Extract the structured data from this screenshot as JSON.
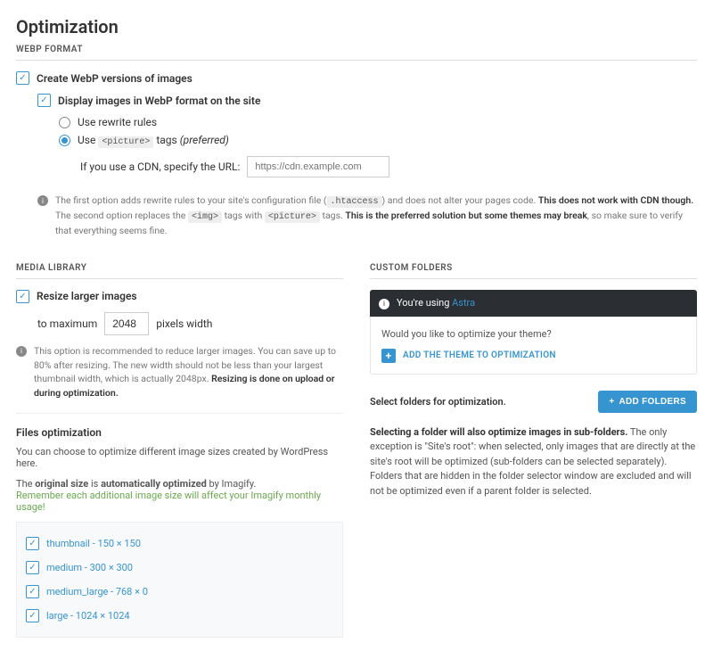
{
  "page_title": "Optimization",
  "webp": {
    "header": "WEBP FORMAT",
    "create_label": "Create WebP versions of images",
    "display_label": "Display images in WebP format on the site",
    "radio_rewrite": "Use rewrite rules",
    "radio_picture_prefix": "Use ",
    "radio_picture_tag": "<picture>",
    "radio_picture_suffix": " tags ",
    "radio_picture_note": "(preferred)",
    "cdn_label": "If you use a CDN, specify the URL:",
    "cdn_placeholder": "https://cdn.example.com",
    "note_line1a": "The first option adds rewrite rules to your site's configuration file (",
    "note_line1_code": ".htaccess",
    "note_line1b": ") and does not alter your pages code. ",
    "note_line1_bold": "This does not work with CDN though.",
    "note_line2a": "The second option replaces the ",
    "note_line2_code1": "<img>",
    "note_line2b": " tags with ",
    "note_line2_code2": "<picture>",
    "note_line2c": " tags. ",
    "note_line2_bold": "This is the preferred solution but some themes may break",
    "note_line2d": ", so make sure to verify that everything seems fine."
  },
  "media": {
    "header": "MEDIA LIBRARY",
    "resize_label": "Resize larger images",
    "to_max": "to maximum",
    "width_value": "2048",
    "px_width": "pixels width",
    "note_a": "This option is recommended to reduce larger images. You can save up to 80% after resizing. The new width should not be less than your largest thumbnail width, which is actually 2048px. ",
    "note_bold": "Resizing is done on upload or during optimization."
  },
  "files": {
    "header": "Files optimization",
    "desc": "You can choose to optimize different image sizes created by WordPress here.",
    "auto_a": "The ",
    "auto_b": "original size",
    "auto_c": " is ",
    "auto_d": "automatically optimized",
    "auto_e": " by Imagify.",
    "warn": "Remember each additional image size will affect your Imagify monthly usage!",
    "sizes": [
      "thumbnail - 150 × 150",
      "medium - 300 × 300",
      "medium_large - 768 × 0",
      "large - 1024 × 1024"
    ]
  },
  "custom": {
    "header": "CUSTOM FOLDERS",
    "using": "You're using ",
    "theme": "Astra",
    "question": "Would you like to optimize your theme?",
    "add_theme": "ADD THE THEME TO OPTIMIZATION",
    "select_label": "Select folders for optimization.",
    "add_folders": "ADD FOLDERS",
    "desc_bold": "Selecting a folder will also optimize images in sub-folders.",
    "desc_a": " The only exception is \"Site's root\": when selected, only images that are directly at the site's root will be optimized (sub-folders can be selected separately).",
    "desc_b": "Folders that are hidden in the folder selector window are excluded and will not be optimized even if a parent folder is selected."
  }
}
